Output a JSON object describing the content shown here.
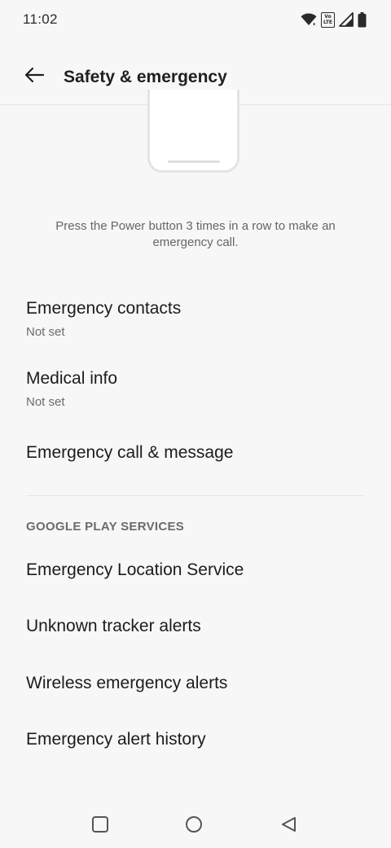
{
  "status_bar": {
    "time": "11:02",
    "icons": [
      "wifi-icon",
      "volte-icon",
      "signal-icon",
      "battery-icon"
    ],
    "volte_label": "Vo LTE"
  },
  "app_bar": {
    "title": "Safety & emergency",
    "back_icon": "arrow-left-icon"
  },
  "emergency_sos": {
    "description": "Press the Power button 3 times in a row to make an emergency call."
  },
  "items": [
    {
      "title": "Emergency contacts",
      "subtitle": "Not set"
    },
    {
      "title": "Medical info",
      "subtitle": "Not set"
    },
    {
      "title": "Emergency call & message"
    }
  ],
  "google_play_services": {
    "header": "GOOGLE PLAY SERVICES",
    "items": [
      {
        "title": "Emergency Location Service"
      },
      {
        "title": "Unknown tracker alerts"
      },
      {
        "title": "Wireless emergency alerts"
      },
      {
        "title": "Emergency alert history"
      }
    ]
  },
  "nav_bar": {
    "icons": [
      "recents-square-icon",
      "home-circle-icon",
      "back-triangle-icon"
    ]
  },
  "colors": {
    "background": "#f7f7f7",
    "text_primary": "#1c1c1c",
    "text_secondary": "#6b6b6b",
    "divider": "#e6e6e6"
  }
}
